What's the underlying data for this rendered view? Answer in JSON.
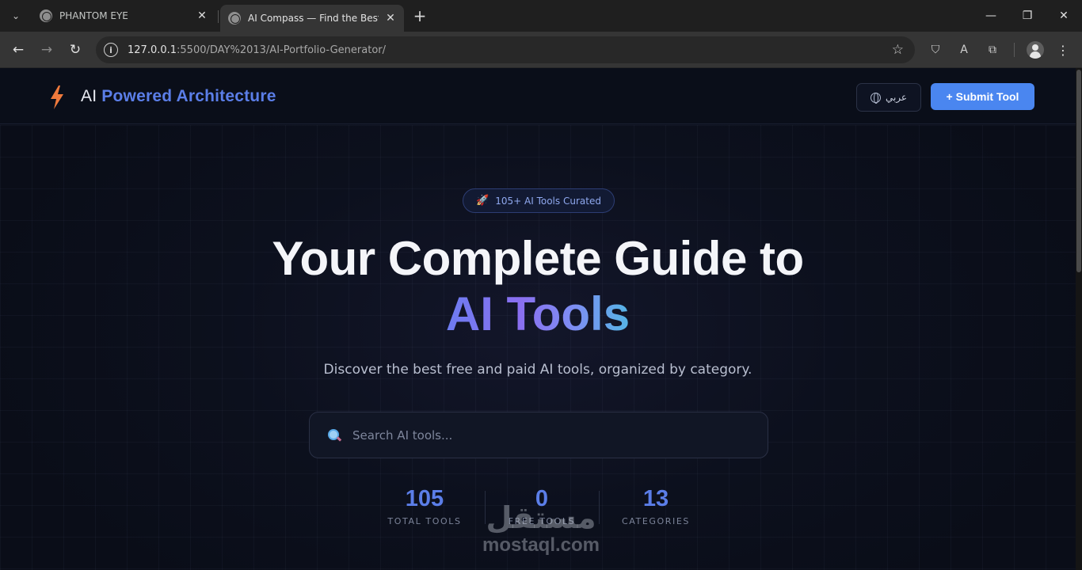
{
  "browser": {
    "tabs": [
      {
        "title": "PHANTOM EYE",
        "active": false
      },
      {
        "title": "AI Compass — Find the Best AI",
        "active": true
      }
    ],
    "url_host": "127.0.0.1",
    "url_rest": ":5500/DAY%2013/AI-Portfolio-Generator/",
    "glyphs": {
      "tab_search": "⌄",
      "close": "✕",
      "new_tab": "+",
      "minimize": "—",
      "maximize": "❐",
      "back": "←",
      "forward": "→",
      "reload": "↻",
      "info": "i",
      "star": "☆",
      "shield": "⛉",
      "translate": "A",
      "puzzle": "⧉",
      "menu": "⋮"
    }
  },
  "header": {
    "brand_prefix": "AI",
    "brand_accent": "Powered Architecture",
    "lang_label": "عربي",
    "submit_label": "+ Submit Tool"
  },
  "hero": {
    "badge_icon": "🚀",
    "badge_text": "105+ AI Tools Curated",
    "title": "Your Complete Guide to",
    "title_accent": "AI Tools",
    "subtitle": "Discover the best free and paid AI tools, organized by category."
  },
  "search": {
    "placeholder": "Search AI tools...",
    "value": ""
  },
  "stats": [
    {
      "value": "105",
      "label": "TOTAL TOOLS"
    },
    {
      "value": "0",
      "label": "FREE TOOLS"
    },
    {
      "value": "13",
      "label": "CATEGORIES"
    }
  ],
  "watermark": {
    "arabic": "مستقل",
    "latin": "mostaql.com"
  },
  "colors": {
    "accent": "#5b7ee8",
    "button": "#4a86f0",
    "bolt": "#f07a3c"
  }
}
